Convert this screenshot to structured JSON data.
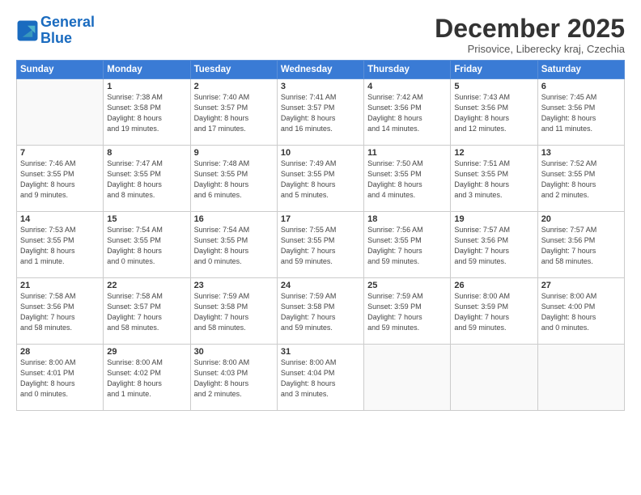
{
  "logo": {
    "line1": "General",
    "line2": "Blue"
  },
  "title": "December 2025",
  "subtitle": "Prisovice, Liberecky kraj, Czechia",
  "days_header": [
    "Sunday",
    "Monday",
    "Tuesday",
    "Wednesday",
    "Thursday",
    "Friday",
    "Saturday"
  ],
  "weeks": [
    [
      {
        "num": "",
        "info": ""
      },
      {
        "num": "1",
        "info": "Sunrise: 7:38 AM\nSunset: 3:58 PM\nDaylight: 8 hours\nand 19 minutes."
      },
      {
        "num": "2",
        "info": "Sunrise: 7:40 AM\nSunset: 3:57 PM\nDaylight: 8 hours\nand 17 minutes."
      },
      {
        "num": "3",
        "info": "Sunrise: 7:41 AM\nSunset: 3:57 PM\nDaylight: 8 hours\nand 16 minutes."
      },
      {
        "num": "4",
        "info": "Sunrise: 7:42 AM\nSunset: 3:56 PM\nDaylight: 8 hours\nand 14 minutes."
      },
      {
        "num": "5",
        "info": "Sunrise: 7:43 AM\nSunset: 3:56 PM\nDaylight: 8 hours\nand 12 minutes."
      },
      {
        "num": "6",
        "info": "Sunrise: 7:45 AM\nSunset: 3:56 PM\nDaylight: 8 hours\nand 11 minutes."
      }
    ],
    [
      {
        "num": "7",
        "info": "Sunrise: 7:46 AM\nSunset: 3:55 PM\nDaylight: 8 hours\nand 9 minutes."
      },
      {
        "num": "8",
        "info": "Sunrise: 7:47 AM\nSunset: 3:55 PM\nDaylight: 8 hours\nand 8 minutes."
      },
      {
        "num": "9",
        "info": "Sunrise: 7:48 AM\nSunset: 3:55 PM\nDaylight: 8 hours\nand 6 minutes."
      },
      {
        "num": "10",
        "info": "Sunrise: 7:49 AM\nSunset: 3:55 PM\nDaylight: 8 hours\nand 5 minutes."
      },
      {
        "num": "11",
        "info": "Sunrise: 7:50 AM\nSunset: 3:55 PM\nDaylight: 8 hours\nand 4 minutes."
      },
      {
        "num": "12",
        "info": "Sunrise: 7:51 AM\nSunset: 3:55 PM\nDaylight: 8 hours\nand 3 minutes."
      },
      {
        "num": "13",
        "info": "Sunrise: 7:52 AM\nSunset: 3:55 PM\nDaylight: 8 hours\nand 2 minutes."
      }
    ],
    [
      {
        "num": "14",
        "info": "Sunrise: 7:53 AM\nSunset: 3:55 PM\nDaylight: 8 hours\nand 1 minute."
      },
      {
        "num": "15",
        "info": "Sunrise: 7:54 AM\nSunset: 3:55 PM\nDaylight: 8 hours\nand 0 minutes."
      },
      {
        "num": "16",
        "info": "Sunrise: 7:54 AM\nSunset: 3:55 PM\nDaylight: 8 hours\nand 0 minutes."
      },
      {
        "num": "17",
        "info": "Sunrise: 7:55 AM\nSunset: 3:55 PM\nDaylight: 7 hours\nand 59 minutes."
      },
      {
        "num": "18",
        "info": "Sunrise: 7:56 AM\nSunset: 3:55 PM\nDaylight: 7 hours\nand 59 minutes."
      },
      {
        "num": "19",
        "info": "Sunrise: 7:57 AM\nSunset: 3:56 PM\nDaylight: 7 hours\nand 59 minutes."
      },
      {
        "num": "20",
        "info": "Sunrise: 7:57 AM\nSunset: 3:56 PM\nDaylight: 7 hours\nand 58 minutes."
      }
    ],
    [
      {
        "num": "21",
        "info": "Sunrise: 7:58 AM\nSunset: 3:56 PM\nDaylight: 7 hours\nand 58 minutes."
      },
      {
        "num": "22",
        "info": "Sunrise: 7:58 AM\nSunset: 3:57 PM\nDaylight: 7 hours\nand 58 minutes."
      },
      {
        "num": "23",
        "info": "Sunrise: 7:59 AM\nSunset: 3:58 PM\nDaylight: 7 hours\nand 58 minutes."
      },
      {
        "num": "24",
        "info": "Sunrise: 7:59 AM\nSunset: 3:58 PM\nDaylight: 7 hours\nand 59 minutes."
      },
      {
        "num": "25",
        "info": "Sunrise: 7:59 AM\nSunset: 3:59 PM\nDaylight: 7 hours\nand 59 minutes."
      },
      {
        "num": "26",
        "info": "Sunrise: 8:00 AM\nSunset: 3:59 PM\nDaylight: 7 hours\nand 59 minutes."
      },
      {
        "num": "27",
        "info": "Sunrise: 8:00 AM\nSunset: 4:00 PM\nDaylight: 8 hours\nand 0 minutes."
      }
    ],
    [
      {
        "num": "28",
        "info": "Sunrise: 8:00 AM\nSunset: 4:01 PM\nDaylight: 8 hours\nand 0 minutes."
      },
      {
        "num": "29",
        "info": "Sunrise: 8:00 AM\nSunset: 4:02 PM\nDaylight: 8 hours\nand 1 minute."
      },
      {
        "num": "30",
        "info": "Sunrise: 8:00 AM\nSunset: 4:03 PM\nDaylight: 8 hours\nand 2 minutes."
      },
      {
        "num": "31",
        "info": "Sunrise: 8:00 AM\nSunset: 4:04 PM\nDaylight: 8 hours\nand 3 minutes."
      },
      {
        "num": "",
        "info": ""
      },
      {
        "num": "",
        "info": ""
      },
      {
        "num": "",
        "info": ""
      }
    ]
  ]
}
